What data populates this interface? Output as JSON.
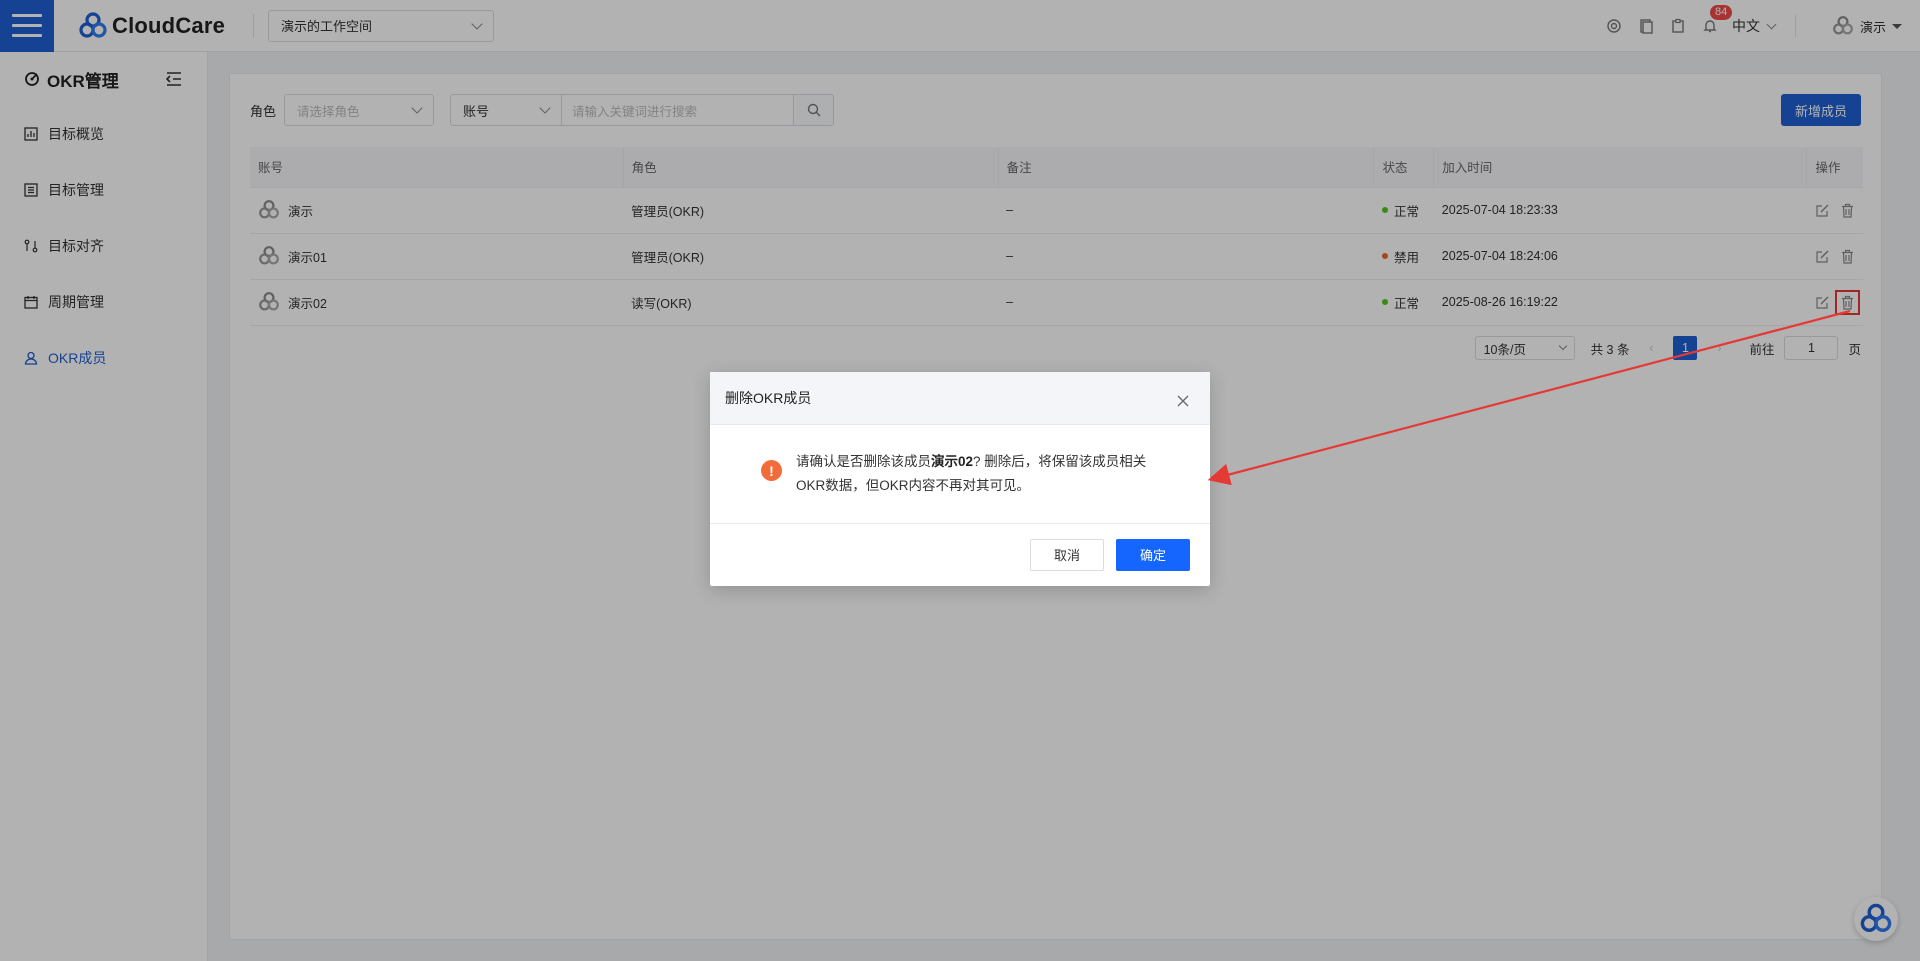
{
  "header": {
    "brand": "CloudCare",
    "workspace": "演示的工作空间",
    "notification_count": "84",
    "language": "中文",
    "username": "演示"
  },
  "sidebar": {
    "title": "OKR管理",
    "items": [
      {
        "label": "目标概览",
        "icon": "overview-icon"
      },
      {
        "label": "目标管理",
        "icon": "goal-list-icon"
      },
      {
        "label": "目标对齐",
        "icon": "align-icon"
      },
      {
        "label": "周期管理",
        "icon": "calendar-icon"
      },
      {
        "label": "OKR成员",
        "icon": "member-icon",
        "active": true
      }
    ]
  },
  "filters": {
    "role_label": "角色",
    "role_placeholder": "请选择角色",
    "field_select": "账号",
    "search_placeholder": "请输入关键词进行搜索",
    "add_button": "新增成员"
  },
  "table": {
    "columns": [
      "账号",
      "角色",
      "备注",
      "状态",
      "加入时间",
      "操作"
    ],
    "rows": [
      {
        "account": "演示",
        "role": "管理员(OKR)",
        "note": "–",
        "status": "正常",
        "status_color": "#52c41a",
        "joined": "2025-07-04 18:23:33"
      },
      {
        "account": "演示01",
        "role": "管理员(OKR)",
        "note": "–",
        "status": "禁用",
        "status_color": "#f5622d",
        "joined": "2025-07-04 18:24:06"
      },
      {
        "account": "演示02",
        "role": "读写(OKR)",
        "note": "–",
        "status": "正常",
        "status_color": "#52c41a",
        "joined": "2025-08-26 16:19:22"
      }
    ]
  },
  "pagination": {
    "page_size": "10条/页",
    "total": "共 3 条",
    "current": "1",
    "goto_label": "前往",
    "goto_value": "1",
    "page_suffix": "页"
  },
  "dialog": {
    "title": "删除OKR成员",
    "message_prefix": "请确认是否删除该成员",
    "member_name": "演示02",
    "message_suffix": "? 删除后，将保留该成员相关OKR数据，但OKR内容不再对其可见。",
    "cancel": "取消",
    "confirm": "确定"
  },
  "colors": {
    "primary": "#1f5fd1",
    "confirm_button": "#1466ff",
    "warning": "#f26b3a",
    "annotation": "#e53935"
  }
}
